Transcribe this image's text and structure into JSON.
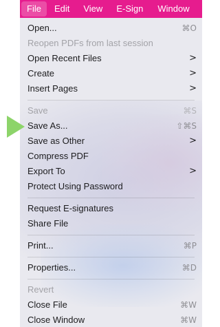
{
  "menubar": {
    "items": [
      {
        "label": "File",
        "active": true
      },
      {
        "label": "Edit",
        "active": false
      },
      {
        "label": "View",
        "active": false
      },
      {
        "label": "E-Sign",
        "active": false
      },
      {
        "label": "Window",
        "active": false
      }
    ],
    "color": "#e61c8e"
  },
  "menu": {
    "items": [
      {
        "label": "Open...",
        "shortcut": "⌘O",
        "enabled": true
      },
      {
        "label": "Reopen PDFs from last session",
        "shortcut": "",
        "enabled": false
      },
      {
        "label": "Open Recent Files",
        "submenu_chevron": ">",
        "enabled": true
      },
      {
        "label": "Create",
        "submenu_chevron": ">",
        "enabled": true
      },
      {
        "label": "Insert Pages",
        "submenu_chevron": ">",
        "enabled": true
      },
      {
        "label": "Save",
        "shortcut": "⌘S",
        "enabled": false
      },
      {
        "label": "Save As...",
        "shortcut": "⇧⌘S",
        "enabled": true,
        "highlighted_by_pointer": true
      },
      {
        "label": "Save as Other",
        "submenu_chevron": ">",
        "enabled": true
      },
      {
        "label": "Compress PDF",
        "enabled": true
      },
      {
        "label": "Export To",
        "submenu_chevron": ">",
        "enabled": true
      },
      {
        "label": "Protect Using Password",
        "enabled": true
      },
      {
        "label": "Request E-signatures",
        "enabled": true
      },
      {
        "label": "Share File",
        "enabled": true
      },
      {
        "label": "Print...",
        "shortcut": "⌘P",
        "enabled": true
      },
      {
        "label": "Properties...",
        "shortcut": "⌘D",
        "enabled": true
      },
      {
        "label": "Revert",
        "enabled": false
      },
      {
        "label": "Close File",
        "shortcut": "⌘W",
        "enabled": true
      },
      {
        "label": "Close Window",
        "shortcut": "⌘W",
        "enabled": true
      }
    ]
  },
  "pointer": {
    "color": "#8dd46a",
    "icon": "green-triangle-arrow"
  }
}
